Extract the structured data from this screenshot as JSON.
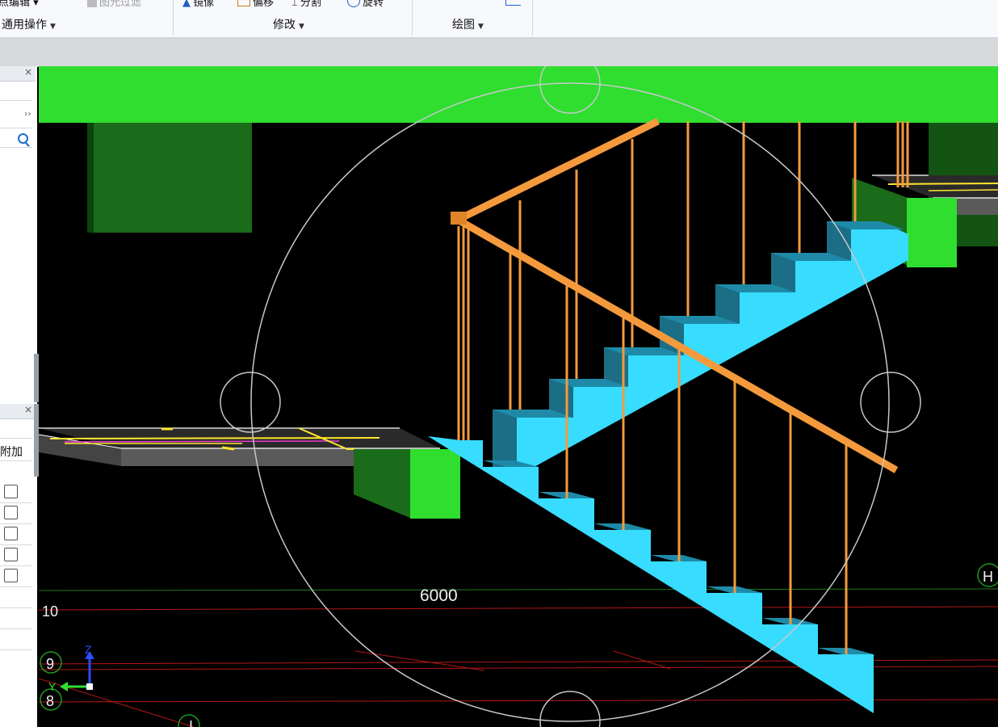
{
  "ribbon": {
    "top_items": [
      {
        "label": "点编辑 ▾",
        "disabled": false
      },
      {
        "label": "图元过滤",
        "disabled": true
      },
      {
        "label": "镜像",
        "disabled": false
      },
      {
        "label": "偏移",
        "disabled": false
      },
      {
        "label": "分割",
        "disabled": false
      },
      {
        "label": "旋转",
        "disabled": false
      }
    ],
    "groups": [
      {
        "label": "通用操作"
      },
      {
        "label": "修改"
      },
      {
        "label": "绘图"
      }
    ]
  },
  "left_panel": {
    "close_glyph": "×",
    "expand_glyph": "››",
    "search_icon": "search-icon",
    "column_header": "附加",
    "checkbox_count": 5
  },
  "viewport": {
    "dimension_label": "6000",
    "axis_labels": {
      "left_top": "10",
      "left_mid": "9",
      "left_bot": "8",
      "right": "H",
      "bottom": "I"
    },
    "gizmo": {
      "z": "Z",
      "y": "Y"
    },
    "colors": {
      "slab": "#2fde2f",
      "stair": "#37dcff",
      "railing": "#f59a3c",
      "column": "#1a6b1a",
      "axis_red": "#cc1f1f"
    }
  }
}
